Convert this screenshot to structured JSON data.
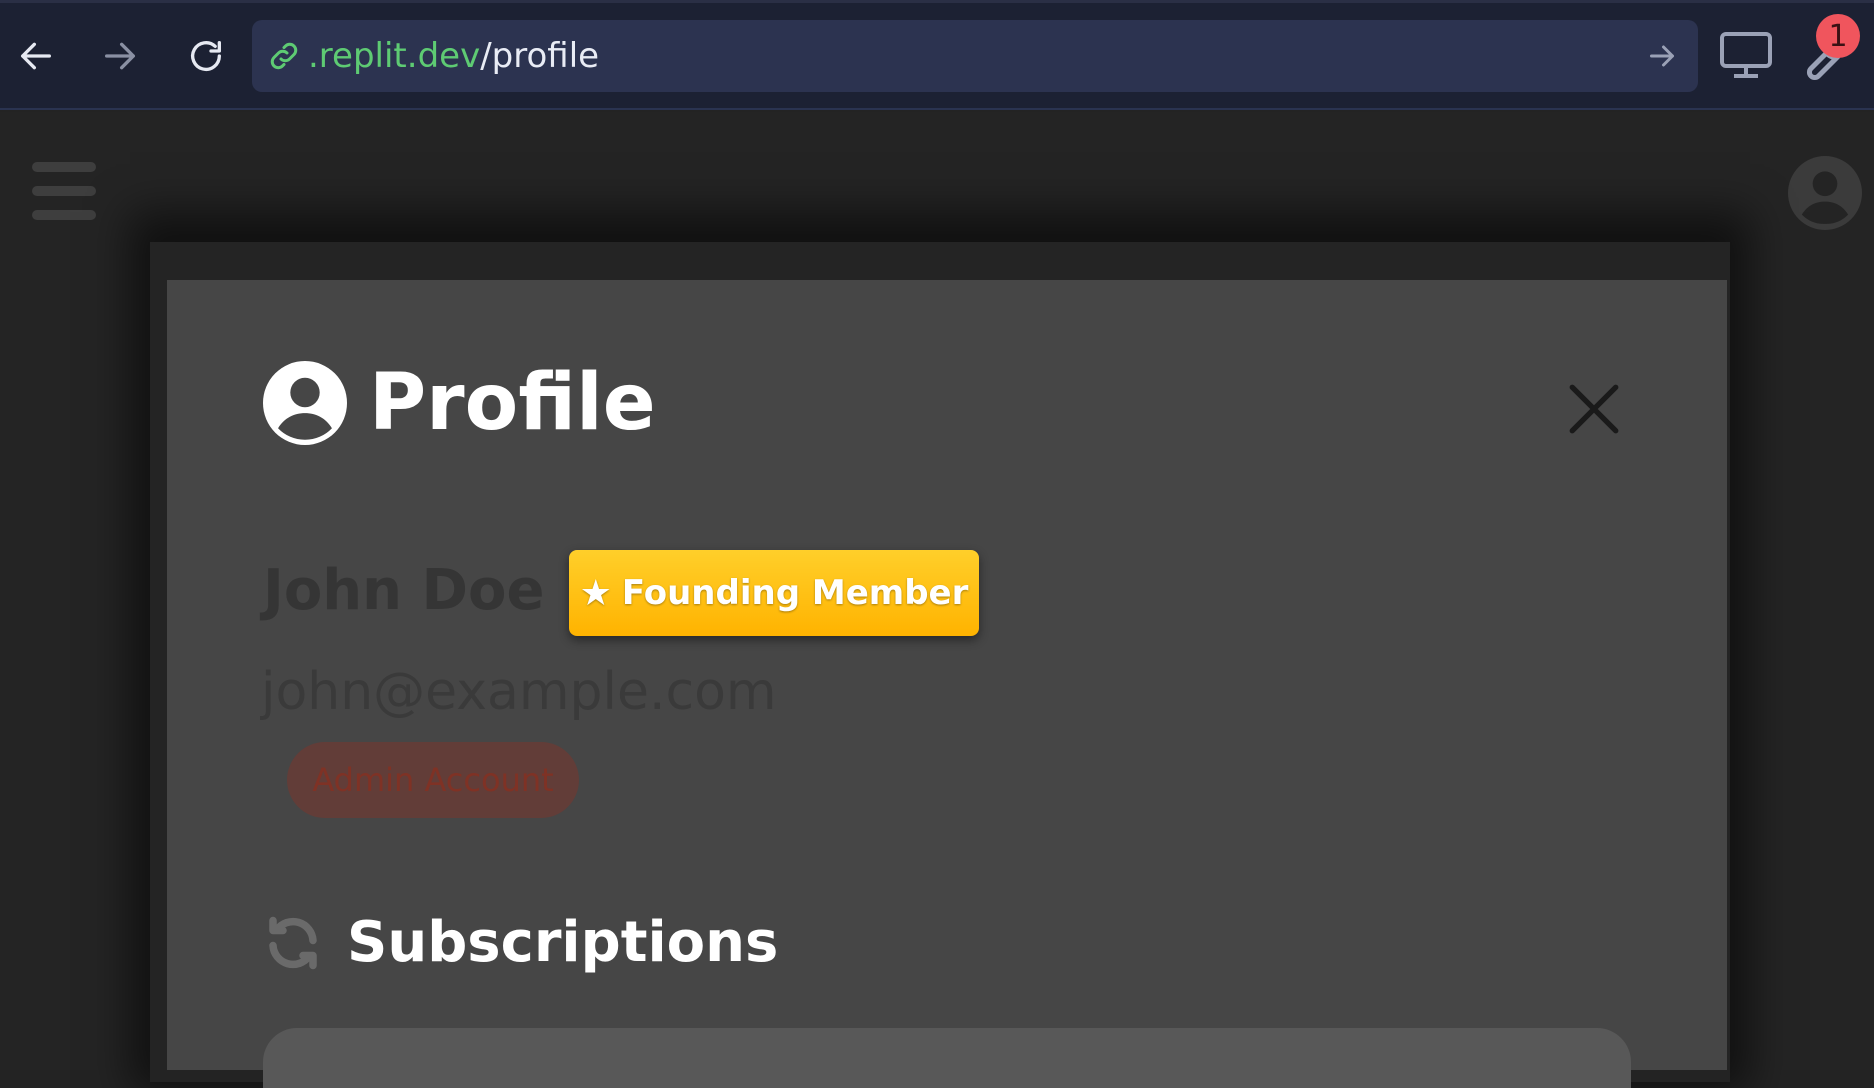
{
  "browser": {
    "url_host": ".replit.dev",
    "url_path": "/profile",
    "notification_count": "1"
  },
  "modal": {
    "title": "Profile",
    "user": {
      "name": "John Doe",
      "badge": "Founding Member",
      "badge_icon": "star-icon",
      "email": "john@example.com",
      "role_label": "Admin Account"
    },
    "subscriptions_title": "Subscriptions"
  },
  "colors": {
    "url_host": "#5ecb73",
    "badge_gold": "#ffb300",
    "modal_bg": "#464646",
    "page_bg": "#242424",
    "notif_badge": "#f0555d"
  }
}
